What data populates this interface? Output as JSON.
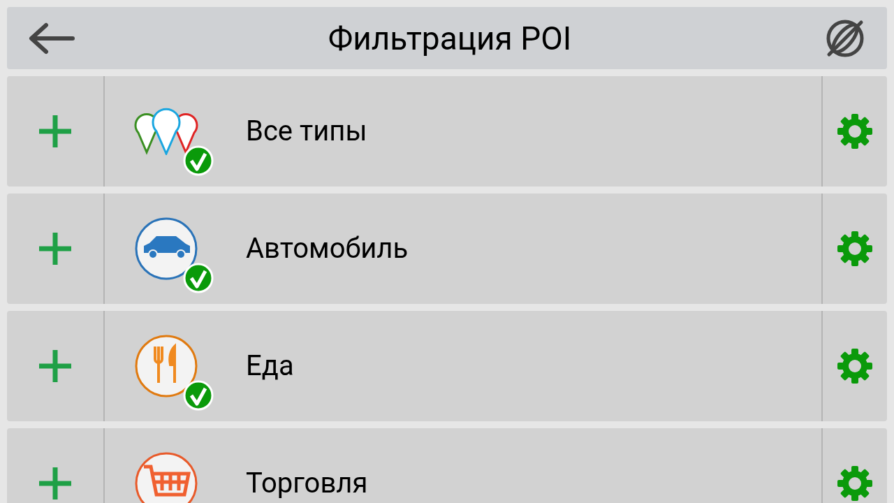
{
  "header": {
    "title": "Фильтрация POI"
  },
  "categories": [
    {
      "kind": "all",
      "label": "Все типы",
      "checked": true
    },
    {
      "kind": "car",
      "label": "Автомобиль",
      "checked": true
    },
    {
      "kind": "food",
      "label": "Еда",
      "checked": true
    },
    {
      "kind": "shop",
      "label": "Торговля"
    }
  ]
}
